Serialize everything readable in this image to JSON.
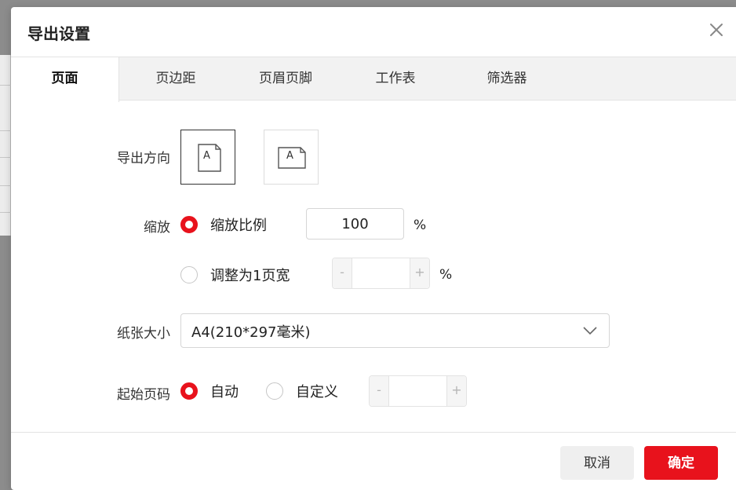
{
  "dialog": {
    "title": "导出设置"
  },
  "tabs": [
    {
      "label": "页面",
      "active": true
    },
    {
      "label": "页边距",
      "active": false
    },
    {
      "label": "页眉页脚",
      "active": false
    },
    {
      "label": "工作表",
      "active": false
    },
    {
      "label": "筛选器",
      "active": false
    }
  ],
  "orientation": {
    "label": "导出方向",
    "portrait_letter": "A",
    "landscape_letter": "A",
    "selected": "portrait"
  },
  "scale": {
    "label": "缩放",
    "option_ratio_label": "缩放比例",
    "ratio_value": "100",
    "ratio_unit": "%",
    "option_fit_label": "调整为1页宽",
    "fit_value": "",
    "fit_unit": "%",
    "minus": "-",
    "plus": "+",
    "selected": "ratio"
  },
  "paper": {
    "label": "纸张大小",
    "selected_value": "A4(210*297毫米)"
  },
  "start_page": {
    "label": "起始页码",
    "option_auto_label": "自动",
    "option_custom_label": "自定义",
    "custom_value": "",
    "minus": "-",
    "plus": "+",
    "selected": "auto"
  },
  "footer": {
    "cancel_label": "取消",
    "ok_label": "确定"
  },
  "colors": {
    "accent": "#e8121c",
    "tab_bar": "#f2f2f2"
  }
}
